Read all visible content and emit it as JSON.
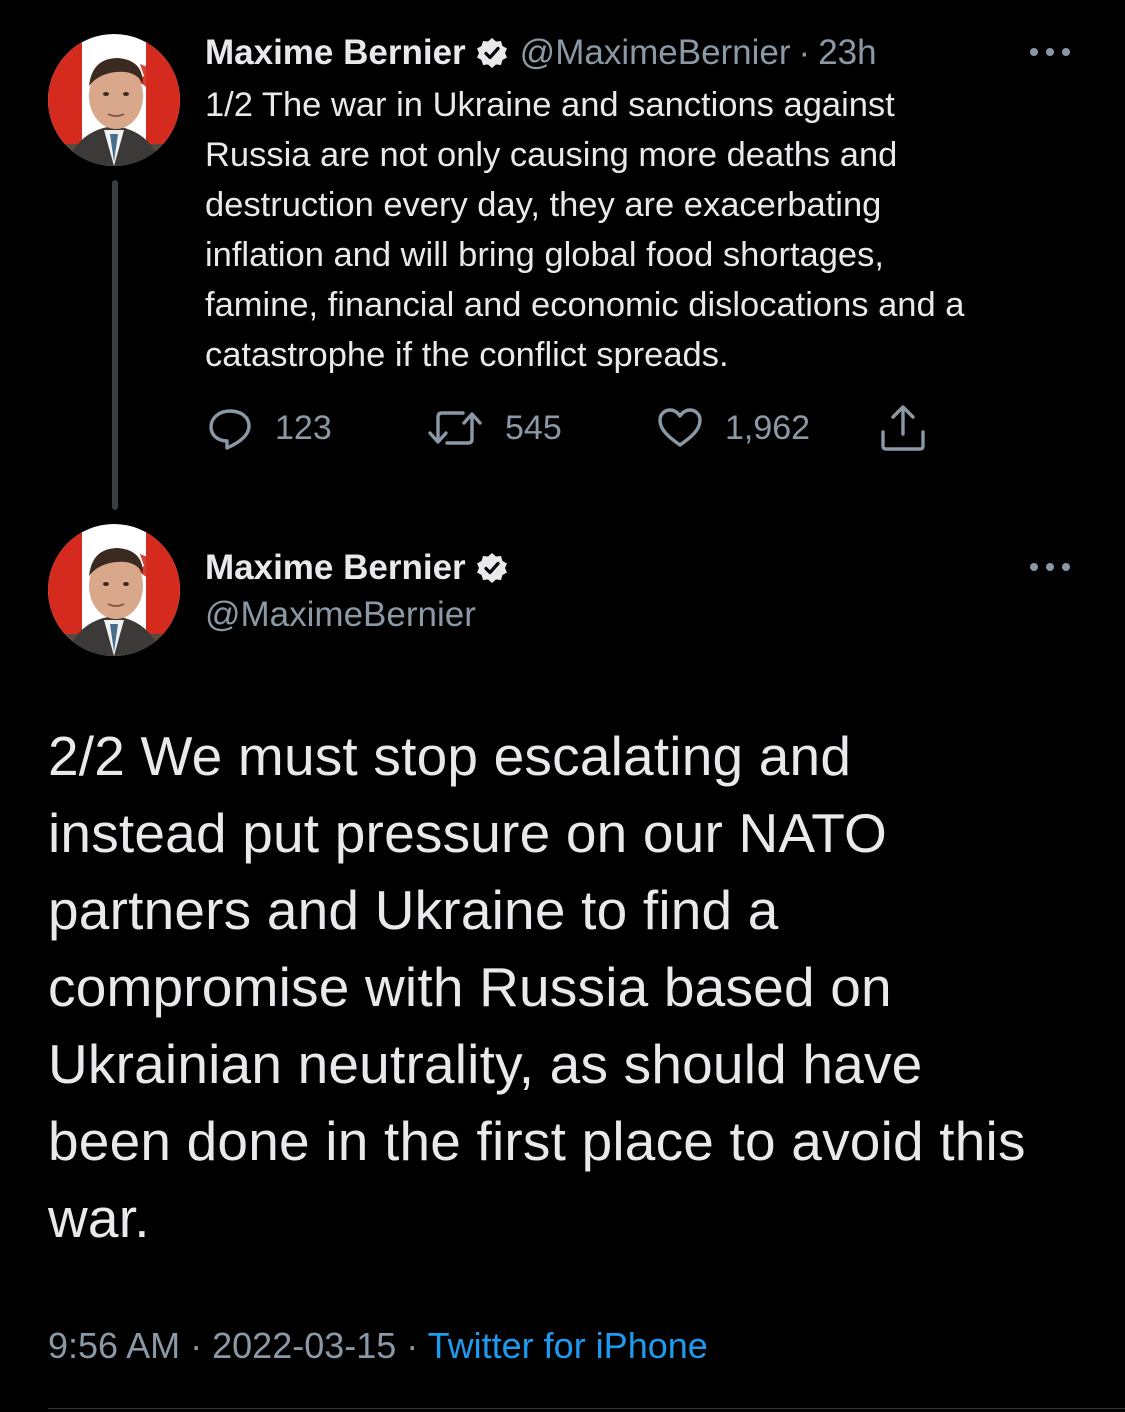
{
  "tweet1": {
    "author_name": "Maxime Bernier",
    "handle": "@MaximeBernier",
    "separator": "·",
    "time_ago": "23h",
    "text": "1/2 The war in Ukraine and sanctions against\nRussia are not only causing more deaths and\ndestruction every day, they are exacerbating\ninflation and will bring global food shortages,\nfamine, financial and economic dislocations and a\ncatastrophe if the conflict spreads.",
    "reply_count": "123",
    "retweet_count": "545",
    "like_count": "1,962"
  },
  "tweet2": {
    "author_name": "Maxime Bernier",
    "handle": "@MaximeBernier",
    "text": "2/2 We must stop escalating and\ninstead put pressure on our NATO\npartners and Ukraine to find a\ncompromise with Russia based on\nUkrainian neutrality, as should have\nbeen done in the first place to avoid this\nwar.",
    "time": "9:56 AM",
    "separator": "·",
    "date": "2022-03-15",
    "source": "Twitter for iPhone"
  },
  "colors": {
    "background": "#000000",
    "text": "#e7e9ea",
    "secondary": "#8b98a5",
    "link": "#1d9bf0",
    "flag_red": "#d52b1e"
  },
  "icons": {
    "verified": "verified-badge-icon",
    "more": "more-options-icon",
    "reply": "reply-icon",
    "retweet": "retweet-icon",
    "like": "like-heart-icon",
    "share": "share-icon"
  }
}
